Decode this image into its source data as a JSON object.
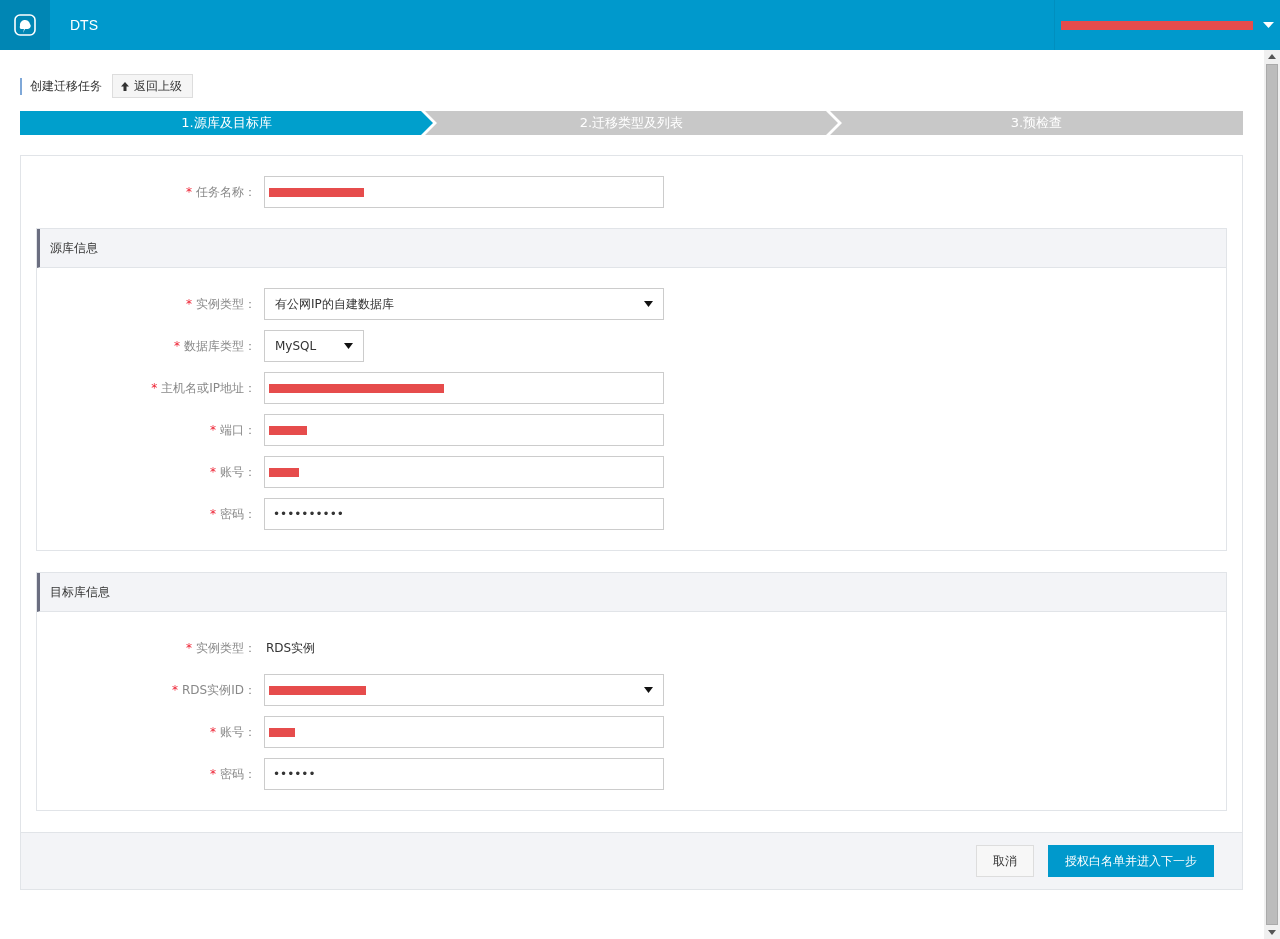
{
  "header": {
    "app_name": "DTS",
    "user_redacted": true
  },
  "page_title": "创建迁移任务",
  "back_button": {
    "label": "返回上级"
  },
  "steps": [
    {
      "label": "1.源库及目标库",
      "selected": true
    },
    {
      "label": "2.迁移类型及列表",
      "selected": false
    },
    {
      "label": "3.预检查",
      "selected": false
    }
  ],
  "task_row": {
    "required_mark": "*",
    "label": "任务名称：",
    "kind": "input",
    "redacted": true
  },
  "sections": [
    {
      "title": "源库信息",
      "rows": [
        {
          "required_mark": "*",
          "label": "实例类型：",
          "kind": "select",
          "value": "有公网IP的自建数据库",
          "redacted": false,
          "compact": false
        },
        {
          "required_mark": "*",
          "label": "数据库类型：",
          "kind": "select",
          "value": "MySQL",
          "redacted": false,
          "compact": true
        },
        {
          "required_mark": "*",
          "label": "主机名或IP地址：",
          "kind": "input",
          "redacted": true
        },
        {
          "required_mark": "*",
          "label": "端口：",
          "kind": "input",
          "redacted": true
        },
        {
          "required_mark": "*",
          "label": "账号：",
          "kind": "input",
          "redacted": true
        },
        {
          "required_mark": "*",
          "label": "密码：",
          "kind": "password",
          "value": "••••••••••",
          "redacted": false
        }
      ]
    },
    {
      "title": "目标库信息",
      "rows": [
        {
          "required_mark": "*",
          "label": "实例类型：",
          "kind": "static",
          "value": "RDS实例",
          "redacted": false
        },
        {
          "required_mark": "*",
          "label": "RDS实例ID：",
          "kind": "select",
          "redacted": true,
          "compact": false
        },
        {
          "required_mark": "*",
          "label": "账号：",
          "kind": "input",
          "redacted": true
        },
        {
          "required_mark": "*",
          "label": "密码：",
          "kind": "password",
          "value": "••••••",
          "redacted": false
        }
      ]
    }
  ],
  "buttons": [
    {
      "label": "取消",
      "kind": "secondary"
    },
    {
      "label": "授权白名单并进入下一步",
      "kind": "primary"
    }
  ]
}
